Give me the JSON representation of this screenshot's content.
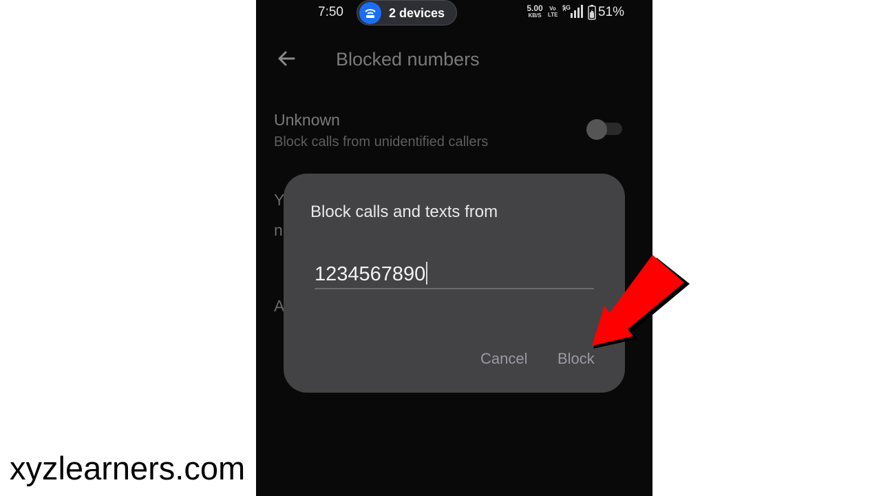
{
  "status_bar": {
    "time": "7:50",
    "hotspot_label": "2 devices",
    "net_speed_value": "5.00",
    "net_speed_unit": "KB/S",
    "volte_top": "Vo",
    "volte_bottom": "LTE",
    "network_type": "5G",
    "battery_percent": "51%"
  },
  "app_bar": {
    "title": "Blocked numbers",
    "back_icon": "back-arrow-icon"
  },
  "unknown_setting": {
    "title": "Unknown",
    "subtitle": "Block calls from unidentified callers",
    "enabled": false
  },
  "obscured_text": {
    "line1": "Y",
    "line2": "n",
    "line3": "A"
  },
  "dialog": {
    "title": "Block calls and texts from",
    "phone_input_value": "1234567890",
    "cancel_label": "Cancel",
    "block_label": "Block"
  },
  "annotation": {
    "arrow_color": "#ff0000",
    "arrow_icon": "red-pointer-arrow-icon"
  },
  "watermark": {
    "text": "xyzlearners.com"
  },
  "colors": {
    "screen_background": "#090909",
    "dialog_background": "#434244",
    "hotspot_accent": "#1b6ef3"
  }
}
